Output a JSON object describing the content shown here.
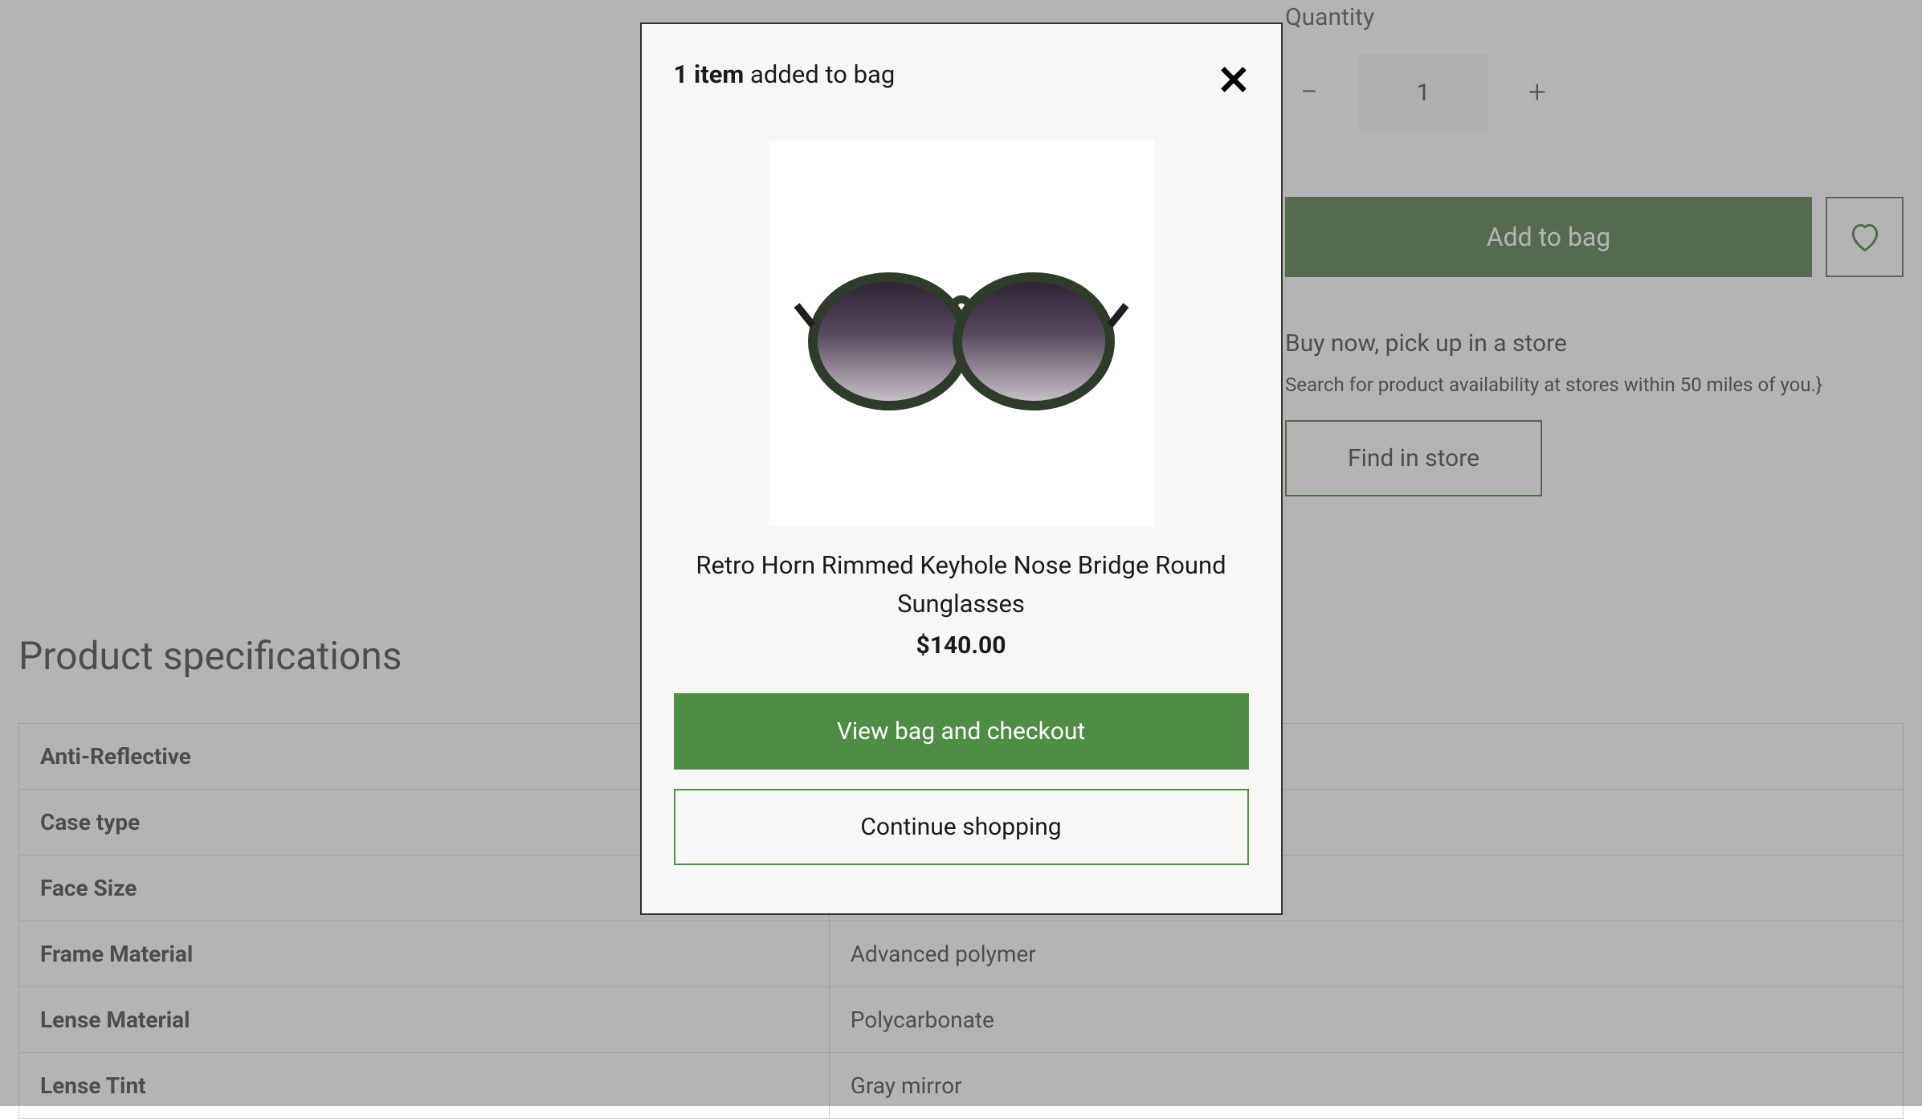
{
  "product": {
    "quantity_label": "Quantity",
    "quantity_value": "1",
    "add_to_bag_label": "Add to bag",
    "pickup_title": "Buy now, pick up in a store",
    "pickup_desc": "Search for product availability at stores within 50 miles of you.}",
    "find_in_store_label": "Find in store"
  },
  "specs": {
    "title": "Product specifications",
    "rows": [
      {
        "key": "Anti-Reflective",
        "value": ""
      },
      {
        "key": "Case type",
        "value": ""
      },
      {
        "key": "Face Size",
        "value": ""
      },
      {
        "key": "Frame Material",
        "value": "Advanced polymer"
      },
      {
        "key": "Lense Material",
        "value": "Polycarbonate"
      },
      {
        "key": "Lense Tint",
        "value": "Gray mirror"
      }
    ]
  },
  "modal": {
    "header_count": "1 item",
    "header_rest": "added to bag",
    "product_name": "Retro Horn Rimmed Keyhole Nose Bridge Round Sunglasses",
    "price": "$140.00",
    "view_bag_label": "View bag and checkout",
    "continue_label": "Continue shopping"
  }
}
